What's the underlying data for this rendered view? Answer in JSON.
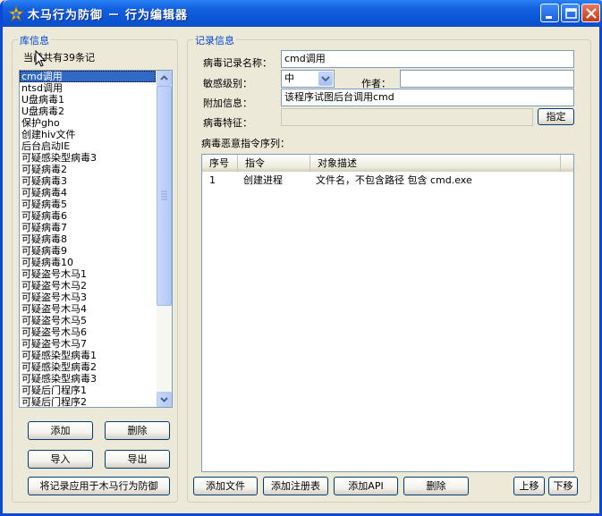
{
  "window": {
    "title": "木马行为防御 － 行为编辑器"
  },
  "library": {
    "group_title": "库信息",
    "count_text": "当前共有39条记",
    "items": [
      "cmd调用",
      "ntsd调用",
      "U盘病毒1",
      "U盘病毒2",
      "保护gho",
      "创建hiv文件",
      "后台启动IE",
      "可疑感染型病毒3",
      "可疑病毒2",
      "可疑病毒3",
      "可疑病毒4",
      "可疑病毒5",
      "可疑病毒6",
      "可疑病毒7",
      "可疑病毒8",
      "可疑病毒9",
      "可疑病毒10",
      "可疑盗号木马1",
      "可疑盗号木马2",
      "可疑盗号木马3",
      "可疑盗号木马4",
      "可疑盗号木马5",
      "可疑盗号木马6",
      "可疑盗号木马7",
      "可疑感染型病毒1",
      "可疑感染型病毒2",
      "可疑感染型病毒3",
      "可疑后门程序1",
      "可疑后门程序2"
    ],
    "selected_index": 0,
    "buttons": {
      "add": "添加",
      "delete": "删除",
      "import": "导入",
      "export": "导出",
      "apply": "将记录应用于木马行为防御"
    }
  },
  "record": {
    "group_title": "记录信息",
    "name_label": "病毒记录名称：",
    "name_value": "cmd调用",
    "level_label": "敏感级别：",
    "level_value": "中",
    "author_label": "作者：",
    "author_value": "",
    "extra_label": "附加信息：",
    "extra_value": "该程序试图后台调用cmd",
    "signature_label": "病毒特征：",
    "signature_value": "",
    "specify_button": "指定",
    "sequence_label": "病毒恶意指令序列：",
    "columns": [
      "序号",
      "指令",
      "对象描述"
    ],
    "rows": [
      {
        "no": "1",
        "cmd": "创建进程",
        "desc": "文件名，不包含路径 包含 cmd.exe"
      }
    ],
    "buttons": {
      "add_file": "添加文件",
      "add_registry": "添加注册表",
      "add_api": "添加API",
      "delete": "删除",
      "move_up": "上移",
      "move_down": "下移"
    }
  }
}
